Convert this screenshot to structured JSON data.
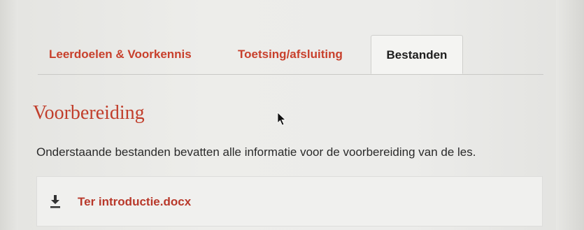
{
  "tabs": [
    {
      "label": "Leerdoelen & Voorkennis",
      "active": false
    },
    {
      "label": "Toetsing/afsluiting",
      "active": false
    },
    {
      "label": "Bestanden",
      "active": true
    }
  ],
  "section": {
    "title": "Voorbereiding",
    "description": "Onderstaande bestanden bevatten alle informatie voor de voorbereiding van de les."
  },
  "files": [
    {
      "name": "Ter introductie.docx",
      "icon": "download-icon"
    }
  ],
  "colors": {
    "accent": "#c8402c",
    "active_tab_text": "#1e1e1e",
    "text": "#2a2a2a"
  }
}
